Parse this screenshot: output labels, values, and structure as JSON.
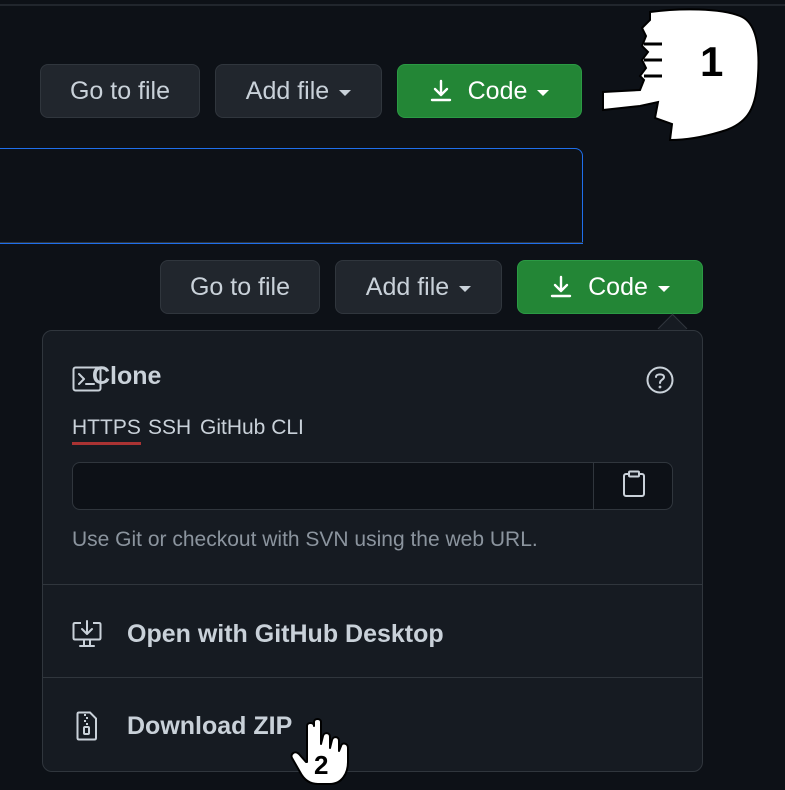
{
  "toolbar_top": {
    "goto_label": "Go to file",
    "addfile_label": "Add file",
    "code_label": "Code"
  },
  "toolbar_mid": {
    "goto_label": "Go to file",
    "addfile_label": "Add file",
    "code_label": "Code"
  },
  "step_markers": {
    "step1": "1",
    "step2": "2"
  },
  "clone_panel": {
    "title": "Clone",
    "tabs": [
      "HTTPS",
      "SSH",
      "GitHub CLI"
    ],
    "active_tab": "HTTPS",
    "url_value": "",
    "help_text": "Use Git or checkout with SVN using the web URL.",
    "items": [
      {
        "label": "Open with GitHub Desktop",
        "icon": "desktop-download-icon"
      },
      {
        "label": "Download ZIP",
        "icon": "file-zip-icon"
      }
    ]
  },
  "colors": {
    "background": "#0d1117",
    "panel": "#161b22",
    "green": "#238636",
    "border": "#30363d",
    "text": "#c9d1d9",
    "muted": "#8b949e",
    "tab_underline": "#aa3333"
  }
}
